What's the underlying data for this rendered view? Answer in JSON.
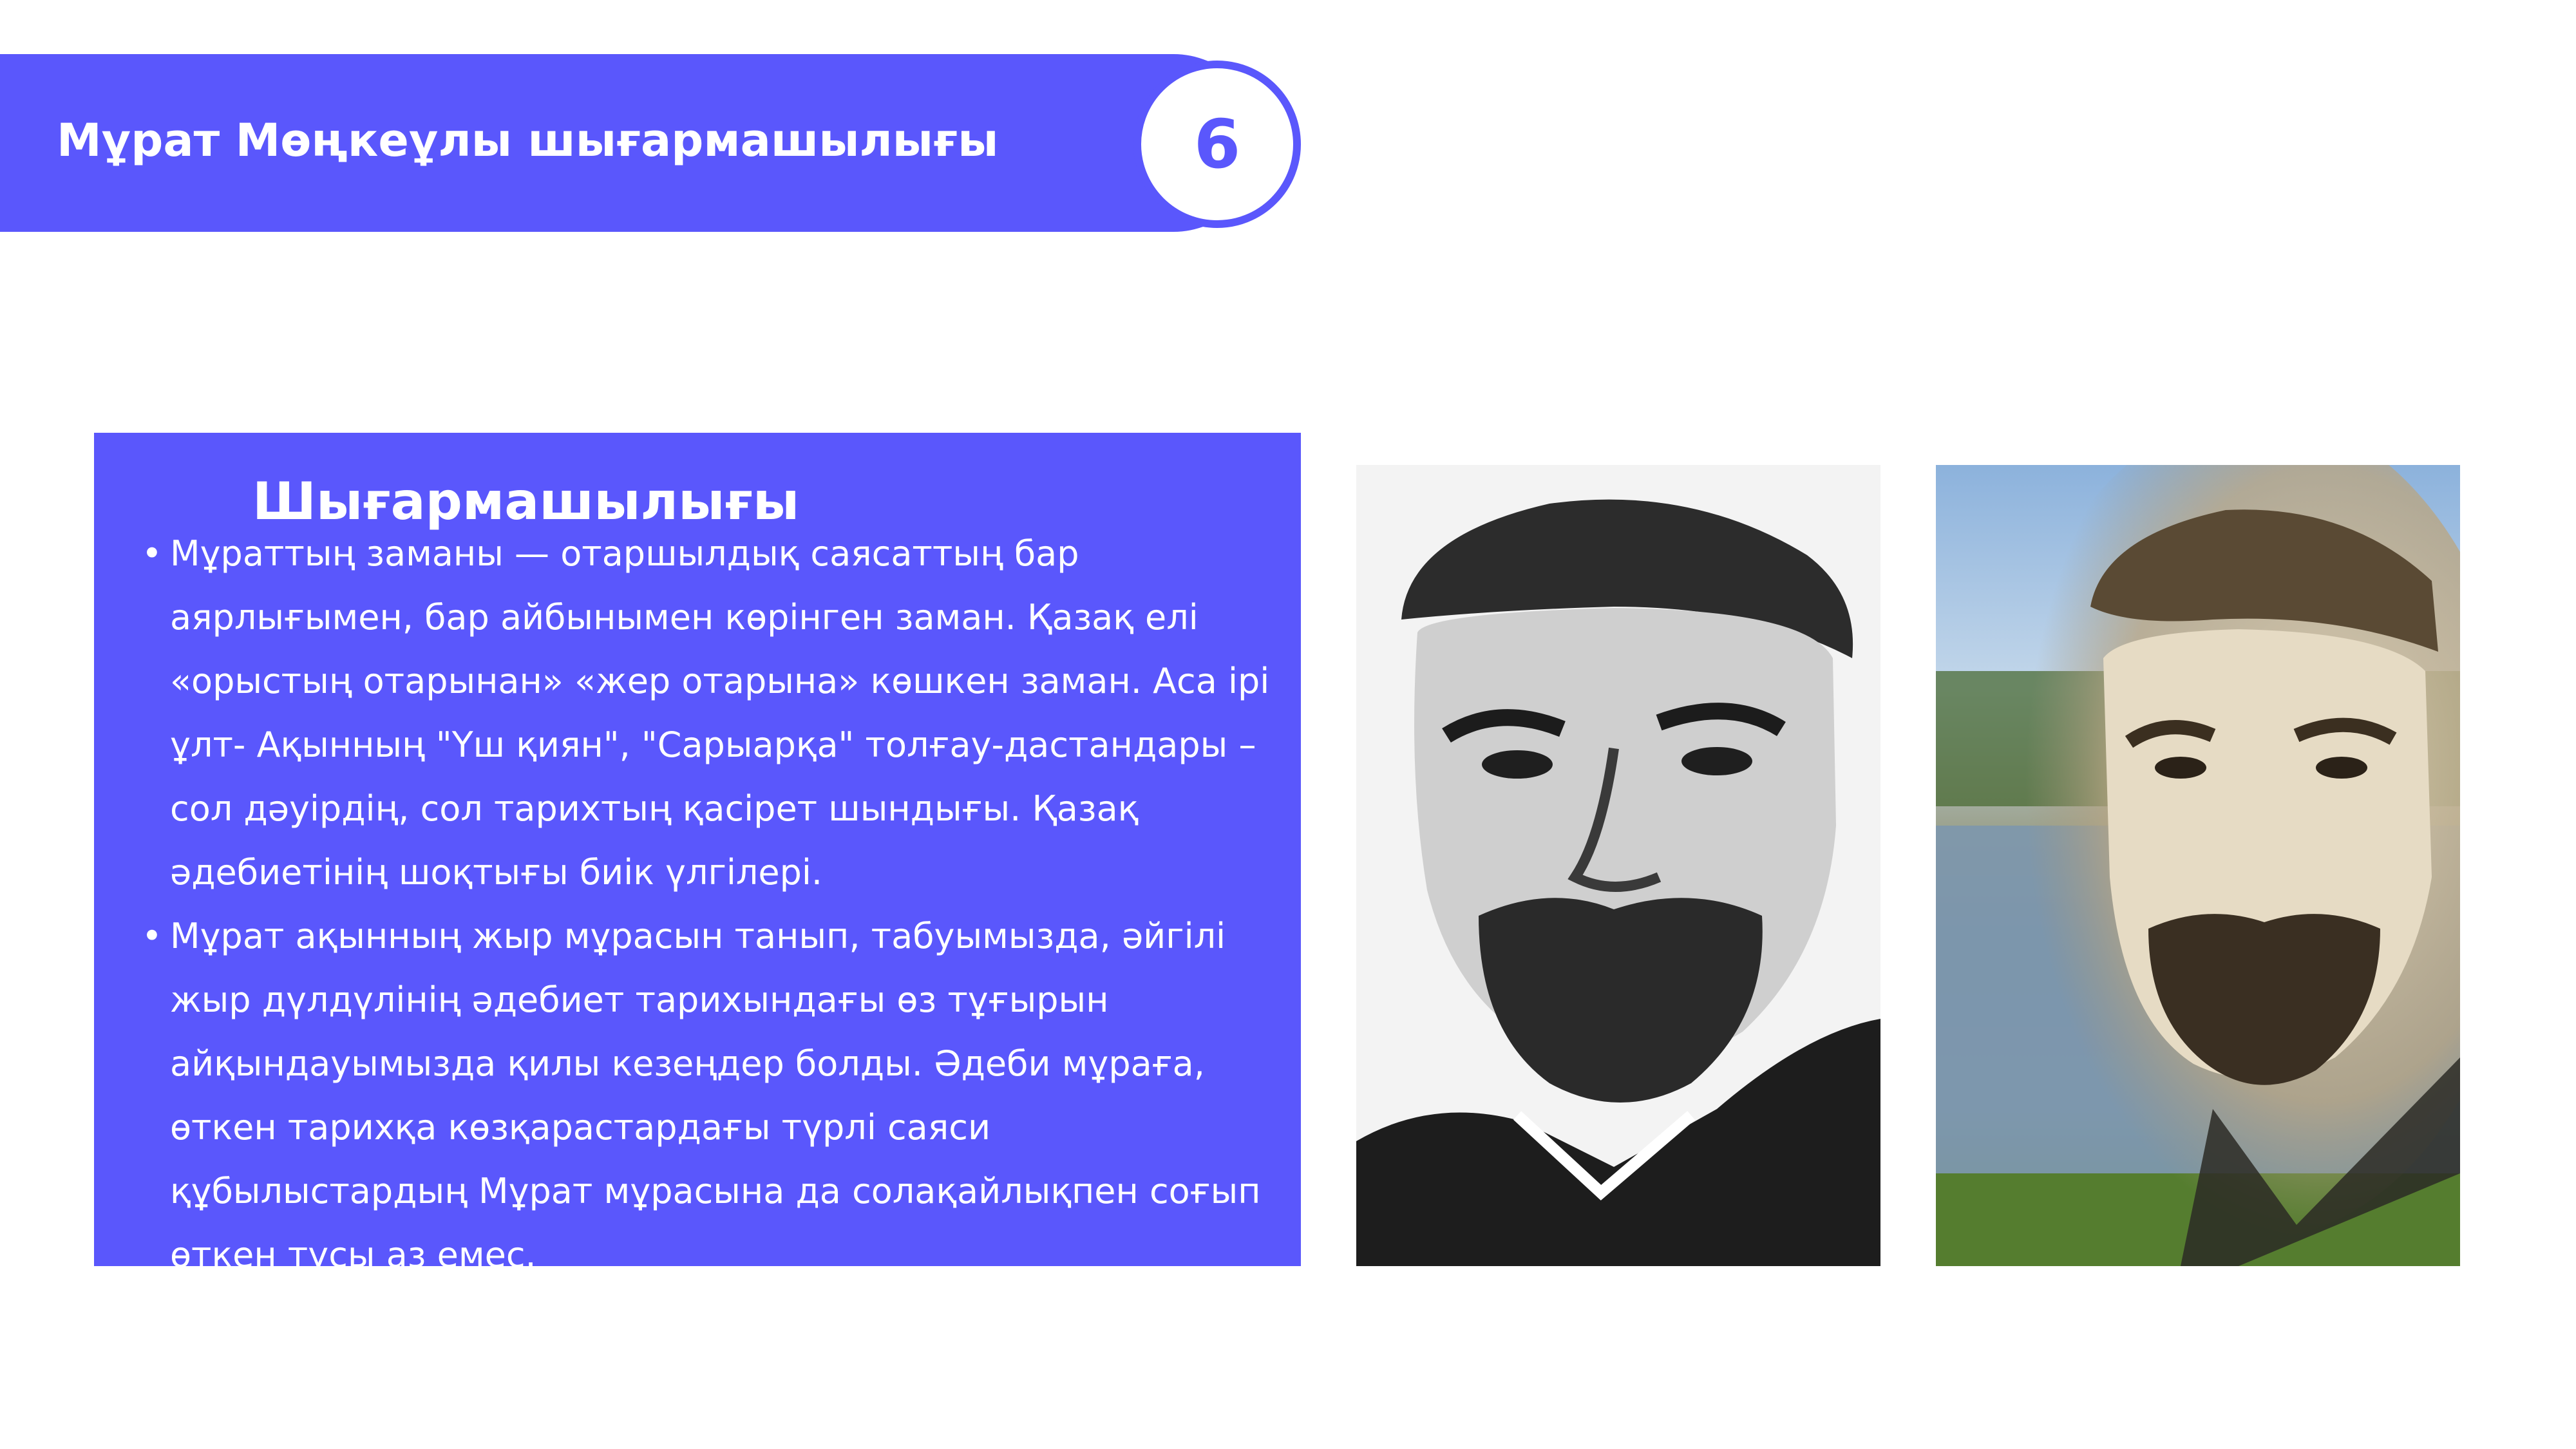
{
  "header": {
    "title": "Мұрат Мөңкеұлы шығармашылығы",
    "slide_number": "6"
  },
  "content": {
    "heading": "Шығармашылығы",
    "bullets": [
      "Мұраттың заманы — отаршылдық саясаттың бар аярлығымен, бар айбынымен көрінген заман. Қазақ елі «орыстың отарынан» «жер отарына» көшкен заман. Аса ірі ұлт- Ақынның \"Үш қиян\", \"Сарыарқа\" толғау-дастандары – сол дәуірдің, сол тарихтың қасірет шындығы. Қазақ әдебиетінің шоқтығы биік үлгілері.",
      " Мұрат ақынның жыр мұрасын танып, табуымызда, әйгілі жыр дүлдүлінің әдебиет тарихындағы өз тұғырын айқындауымызда қилы кезеңдер болды. Әдеби мұраға, өткен тарихқа көзқарастардағы түрлі саяси құбылыстардың Мұрат мұрасына да солақайлықпен соғып өткен тұсы аз емес."
    ]
  },
  "images": {
    "portrait_1": "portrait-drawing",
    "portrait_2": "portrait-over-lake"
  },
  "colors": {
    "accent": "#5a57fc",
    "text_on_accent": "#ffffff",
    "background": "#ffffff"
  }
}
